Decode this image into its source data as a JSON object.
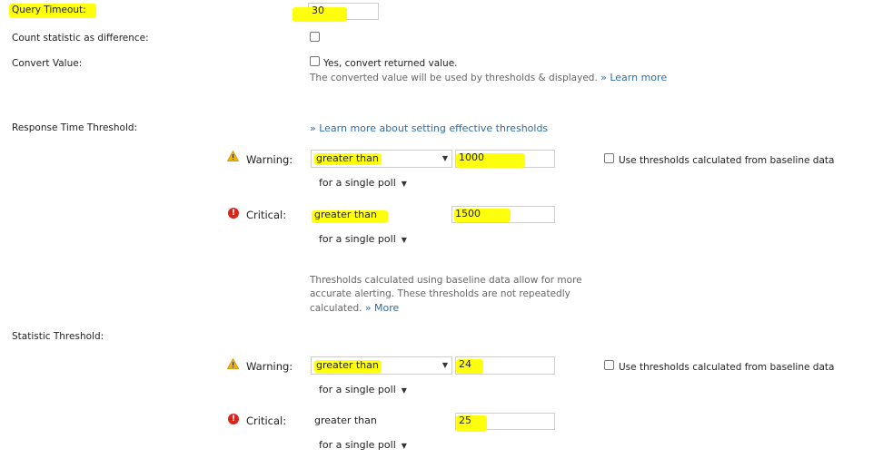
{
  "query_timeout": {
    "label": "Query Timeout:",
    "value": "30"
  },
  "count_statistic": {
    "label": "Count statistic as difference:"
  },
  "convert_value": {
    "label": "Convert Value:",
    "checkbox_label": "Yes, convert returned value.",
    "hint": "The converted value will be used by thresholds & displayed.",
    "learn_more": "» Learn more"
  },
  "response_time_threshold": {
    "label": "Response Time Threshold:",
    "learn_more_link": "» Learn more about setting effective thresholds",
    "warning": {
      "label": "Warning:",
      "operator": "greater than",
      "value": "1000",
      "poll": "for a single poll"
    },
    "critical": {
      "label": "Critical:",
      "operator": "greater than",
      "value": "1500",
      "poll": "for a single poll"
    },
    "baseline_label": "Use thresholds calculated from baseline data",
    "baseline_hint_1": "Thresholds calculated using baseline data allow for more",
    "baseline_hint_2": "accurate alerting. These thresholds are not repeatedly",
    "baseline_hint_3": "calculated.",
    "more": "» More"
  },
  "statistic_threshold": {
    "label": "Statistic Threshold:",
    "warning": {
      "label": "Warning:",
      "operator": "greater than",
      "value": "24",
      "poll": "for a single poll"
    },
    "critical": {
      "label": "Critical:",
      "operator": "greater than",
      "value": "25",
      "poll": "for a single poll"
    },
    "baseline_label": "Use thresholds calculated from baseline data"
  },
  "colors": {
    "highlight": "#ffff00",
    "link": "#2e6da4",
    "critical": "#d9261c",
    "warning": "#f0b400"
  },
  "icons": {
    "warning": "warning-triangle-icon",
    "critical": "critical-circle-icon"
  }
}
